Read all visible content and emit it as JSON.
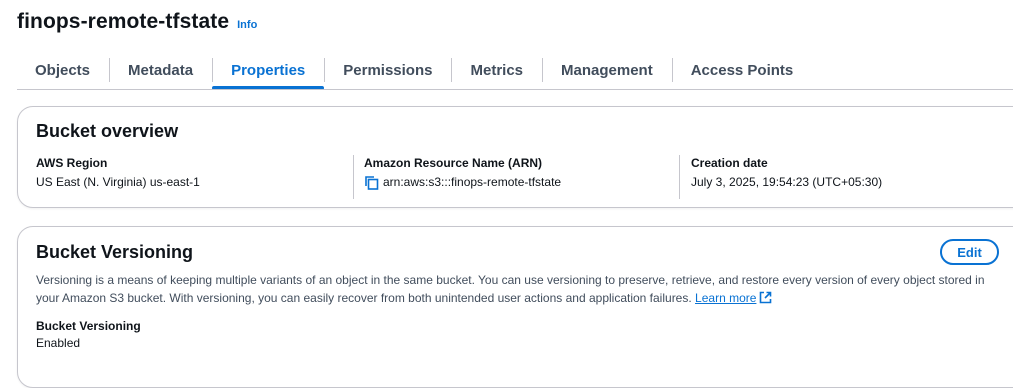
{
  "header": {
    "bucket_name": "finops-remote-tfstate",
    "info_link": "Info"
  },
  "tabs": [
    {
      "label": "Objects",
      "active": false
    },
    {
      "label": "Metadata",
      "active": false
    },
    {
      "label": "Properties",
      "active": true
    },
    {
      "label": "Permissions",
      "active": false
    },
    {
      "label": "Metrics",
      "active": false
    },
    {
      "label": "Management",
      "active": false
    },
    {
      "label": "Access Points",
      "active": false
    }
  ],
  "overview": {
    "title": "Bucket overview",
    "region_label": "AWS Region",
    "region_value": "US East (N. Virginia) us-east-1",
    "arn_label": "Amazon Resource Name (ARN)",
    "arn_value": "arn:aws:s3:::finops-remote-tfstate",
    "arn_icon": "copy-icon",
    "created_label": "Creation date",
    "created_value": "July 3, 2025, 19:54:23 (UTC+05:30)"
  },
  "versioning": {
    "title": "Bucket Versioning",
    "edit_label": "Edit",
    "description": "Versioning is a means of keeping multiple variants of an object in the same bucket. You can use versioning to preserve, retrieve, and restore every version of every object stored in your Amazon S3 bucket. With versioning, you can easily recover from both unintended user actions and application failures.",
    "learn_more": "Learn more",
    "learn_more_icon": "external-link-icon",
    "status_label": "Bucket Versioning",
    "status_value": "Enabled"
  },
  "colors": {
    "accent": "#0972d3",
    "text": "#0f141a",
    "secondary_text": "#414d5c",
    "border": "#c6c6cd"
  }
}
